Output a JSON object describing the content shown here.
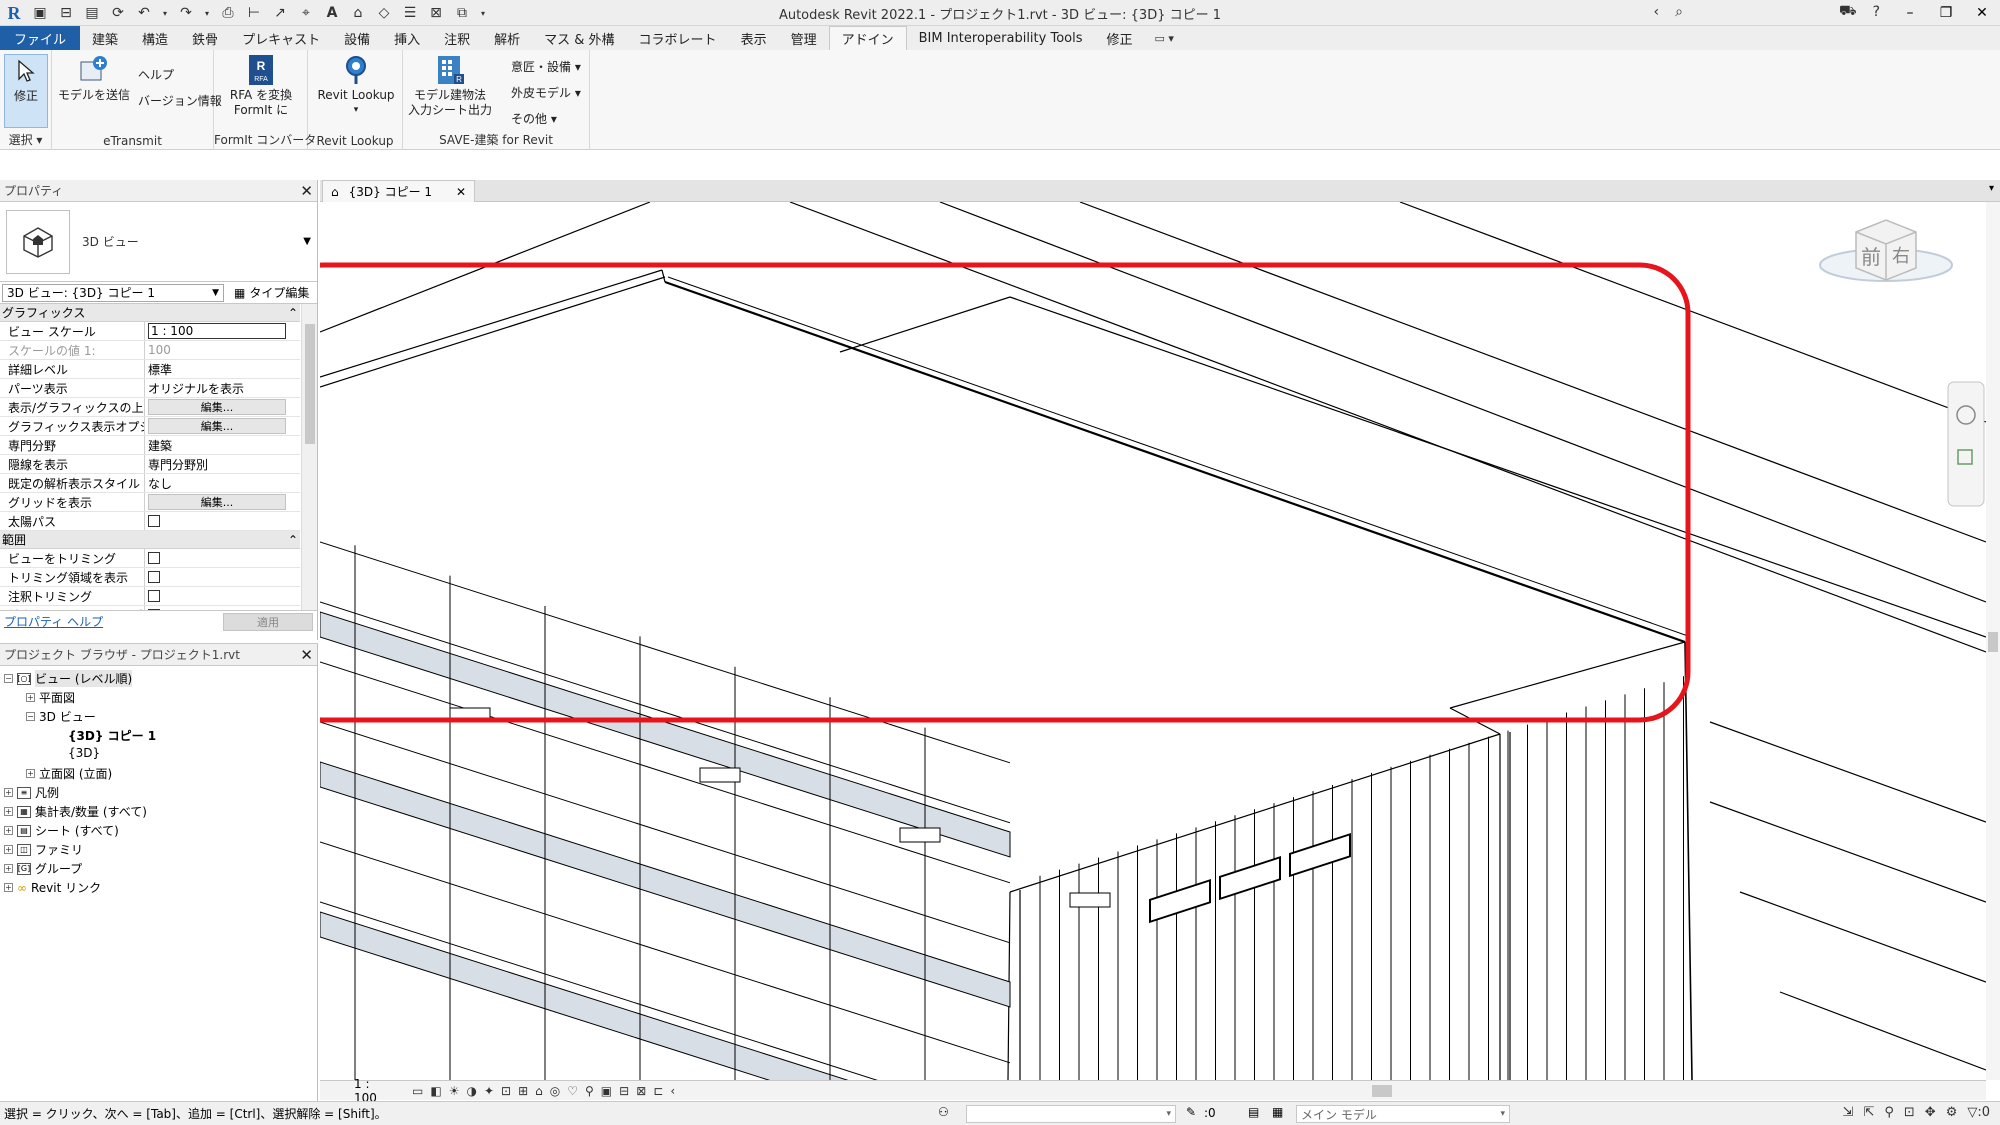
{
  "window": {
    "title": "Autodesk Revit 2022.1 - プロジェクト1.rvt - 3D ビュー: {3D} コピー 1"
  },
  "ribbon_tabs": [
    "ファイル",
    "建築",
    "構造",
    "鉄骨",
    "プレキャスト",
    "設備",
    "挿入",
    "注釈",
    "解析",
    "マス & 外構",
    "コラボレート",
    "表示",
    "管理",
    "アドイン",
    "BIM Interoperability Tools",
    "修正"
  ],
  "active_tab": "アドイン",
  "ribbon": {
    "modify": {
      "label": "修正",
      "panel": "選択"
    },
    "etransmit": {
      "send": "モデルを送信",
      "help": "ヘルプ",
      "version": "バージョン情報",
      "panel": "eTransmit"
    },
    "formit": {
      "line1": "RFA を変換",
      "line2": "FormIt に",
      "panel": "FormIt コンバータ"
    },
    "lookup": {
      "label": "Revit Lookup",
      "panel": "Revit Lookup"
    },
    "save": {
      "line1": "モデル建物法",
      "line2": "入力シート出力",
      "panel": "SAVE-建築 for Revit",
      "items": [
        "意匠・設備",
        "外皮モデル",
        "その他"
      ]
    }
  },
  "properties": {
    "title": "プロパティ",
    "type_name": "3D ビュー",
    "instance_selector": "3D ビュー: {3D} コピー 1",
    "edit_type": "タイプ編集",
    "groups": [
      {
        "name": "グラフィックス",
        "rows": [
          {
            "key": "ビュー スケール",
            "value": "1 : 100",
            "kind": "input"
          },
          {
            "key": "スケールの値    1:",
            "value": "100",
            "kind": "grey"
          },
          {
            "key": "詳細レベル",
            "value": "標準",
            "kind": "text"
          },
          {
            "key": "パーツ表示",
            "value": "オリジナルを表示",
            "kind": "text"
          },
          {
            "key": "表示/グラフィックスの上...",
            "value": "編集...",
            "kind": "button"
          },
          {
            "key": "グラフィックス表示オプション",
            "value": "編集...",
            "kind": "button"
          },
          {
            "key": "専門分野",
            "value": "建築",
            "kind": "text"
          },
          {
            "key": "隠線を表示",
            "value": "専門分野別",
            "kind": "text"
          },
          {
            "key": "既定の解析表示スタイル",
            "value": "なし",
            "kind": "text"
          },
          {
            "key": "グリッドを表示",
            "value": "編集...",
            "kind": "button"
          },
          {
            "key": "太陽パス",
            "value": "",
            "kind": "check"
          }
        ]
      },
      {
        "name": "範囲",
        "rows": [
          {
            "key": "ビューをトリミング",
            "value": "",
            "kind": "check"
          },
          {
            "key": "トリミング領域を表示",
            "value": "",
            "kind": "check"
          },
          {
            "key": "注釈トリミング",
            "value": "",
            "kind": "check"
          },
          {
            "key": "前方クリップ アクティブ",
            "value": "",
            "kind": "check"
          }
        ]
      }
    ],
    "help_link": "プロパティ ヘルプ",
    "apply": "適用"
  },
  "project_browser": {
    "title": "プロジェクト ブラウザ - プロジェクト1.rvt",
    "items": [
      {
        "label": "ビュー (レベル順)",
        "level": 0,
        "toggle": "−"
      },
      {
        "label": "平面図",
        "level": 1,
        "toggle": "+"
      },
      {
        "label": "3D ビュー",
        "level": 1,
        "toggle": "−"
      },
      {
        "label": "{3D} コピー 1",
        "level": 2,
        "toggle": "",
        "bold": true
      },
      {
        "label": "{3D}",
        "level": 2,
        "toggle": ""
      },
      {
        "label": "立面図 (立面)",
        "level": 1,
        "toggle": "+"
      },
      {
        "label": "凡例",
        "level": 0,
        "toggle": "+"
      },
      {
        "label": "集計表/数量 (すべて)",
        "level": 0,
        "toggle": "+"
      },
      {
        "label": "シート (すべて)",
        "level": 0,
        "toggle": "+"
      },
      {
        "label": "ファミリ",
        "level": 0,
        "toggle": "+"
      },
      {
        "label": "グループ",
        "level": 0,
        "toggle": "+"
      },
      {
        "label": "Revit リンク",
        "level": 0,
        "toggle": ""
      }
    ]
  },
  "view_tab": "{3D} コピー 1",
  "viewcube": {
    "front": "前",
    "right": "右"
  },
  "view_control": {
    "scale": "1 : 100"
  },
  "status": {
    "text": "選択 = クリック、次へ = [Tab]、追加 = [Ctrl]、選択解除 = [Shift]。",
    "counter1": ":0",
    "model": "メイン モデル",
    "counter2": ":0"
  },
  "annotation": {
    "highlight_color": "#e8141b"
  }
}
